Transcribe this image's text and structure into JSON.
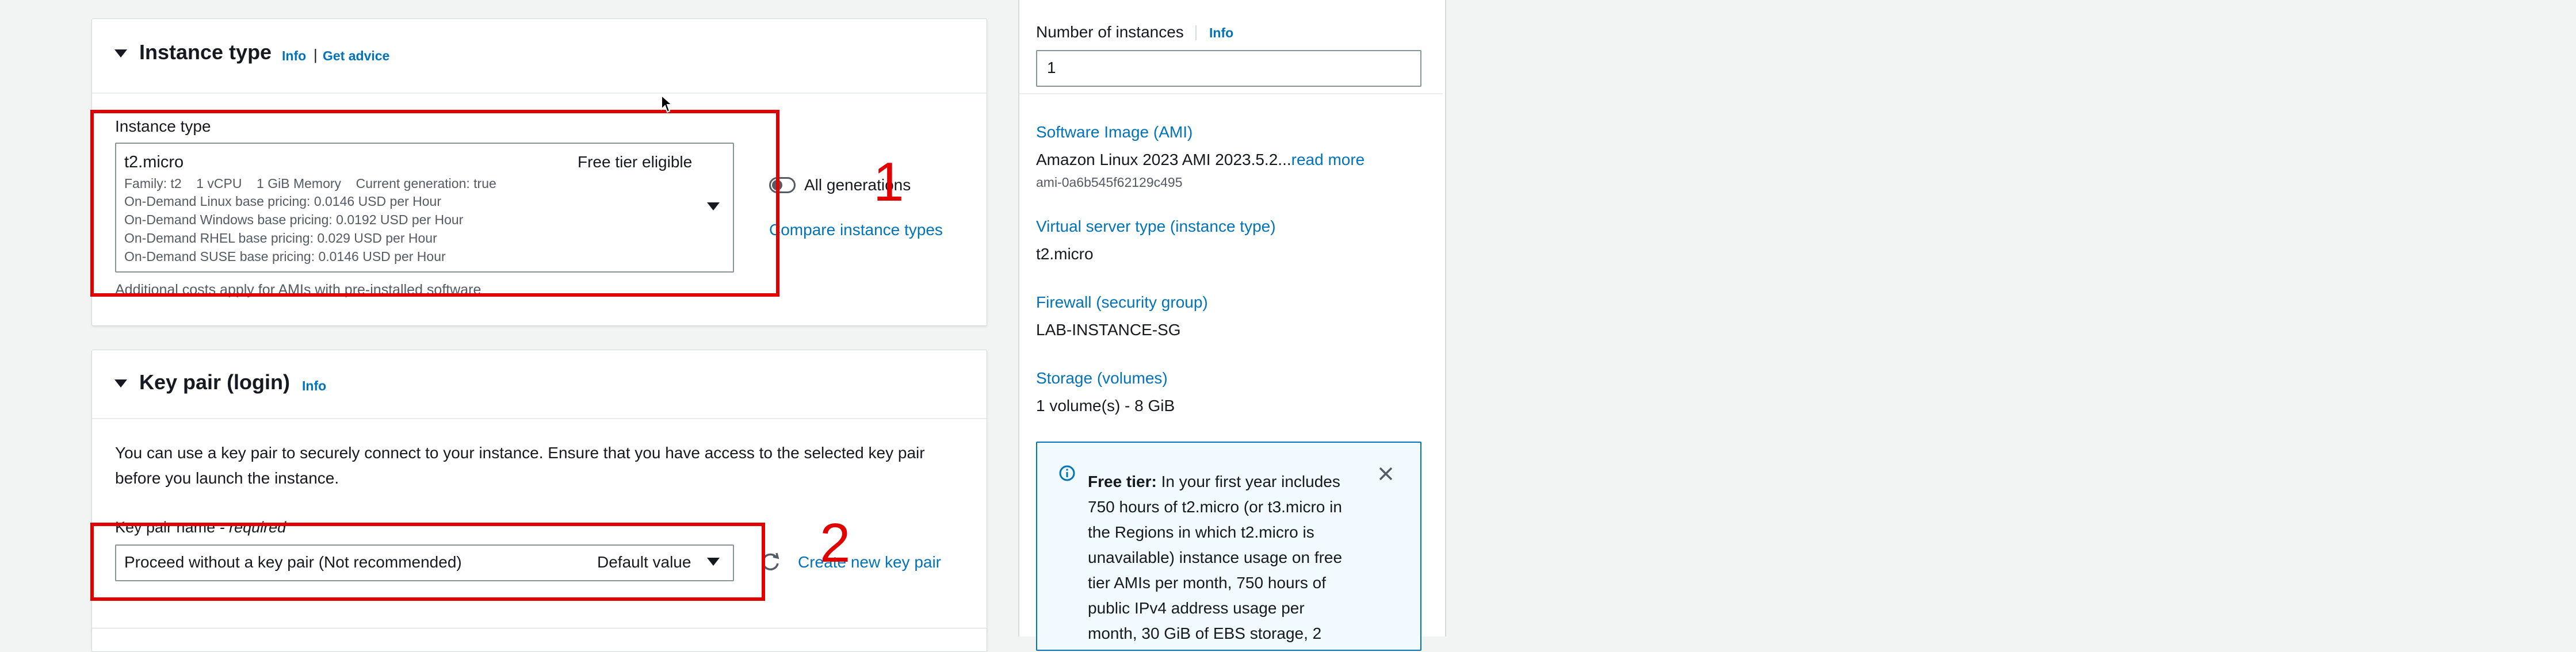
{
  "instance_type_section": {
    "title": "Instance type",
    "info_link": "Info",
    "separator": "|",
    "advice_link": "Get advice",
    "field_label": "Instance type",
    "selected": {
      "name": "t2.micro",
      "badge": "Free tier eligible",
      "details": "Family: t2    1 vCPU    1 GiB Memory    Current generation: true",
      "pricing": [
        "On-Demand Linux base pricing: 0.0146 USD per Hour",
        "On-Demand Windows base pricing: 0.0192 USD per Hour",
        "On-Demand RHEL base pricing: 0.029 USD per Hour",
        "On-Demand SUSE base pricing: 0.0146 USD per Hour"
      ]
    },
    "all_generations_label": "All generations",
    "compare_link": "Compare instance types",
    "footer_note": "Additional costs apply for AMIs with pre-installed software"
  },
  "key_pair_section": {
    "title": "Key pair (login)",
    "info_link": "Info",
    "description_line1": "You can use a key pair to securely connect to your instance. Ensure that you have access to the selected key pair",
    "description_line2": "before you launch the instance.",
    "field_label": "Key pair name",
    "required_suffix": "- required",
    "selected_value": "Proceed without a key pair (Not recommended)",
    "default_badge": "Default value",
    "create_link": "Create new key pair"
  },
  "summary": {
    "instances_label": "Number of instances",
    "instances_info": "Info",
    "instances_value": "1",
    "ami_label": "Software Image (AMI)",
    "ami_value": "Amazon Linux 2023 AMI 2023.5.2...",
    "ami_read_more": "read more",
    "ami_id": "ami-0a6b545f62129c495",
    "server_type_label": "Virtual server type (instance type)",
    "server_type_value": "t2.micro",
    "firewall_label": "Firewall (security group)",
    "firewall_value": "LAB-INSTANCE-SG",
    "storage_label": "Storage (volumes)",
    "storage_value": "1 volume(s) - 8 GiB",
    "free_tier": {
      "bold": "Free tier:",
      "lines": [
        "In your first year includes",
        "750 hours of t2.micro (or t3.micro in",
        "the Regions in which t2.micro is",
        "unavailable) instance usage on free",
        "tier AMIs per month, 750 hours of",
        "public IPv4 address usage per",
        "month, 30 GiB of EBS storage, 2"
      ]
    }
  },
  "annotations": {
    "marker_1": "1",
    "marker_2": "2"
  }
}
